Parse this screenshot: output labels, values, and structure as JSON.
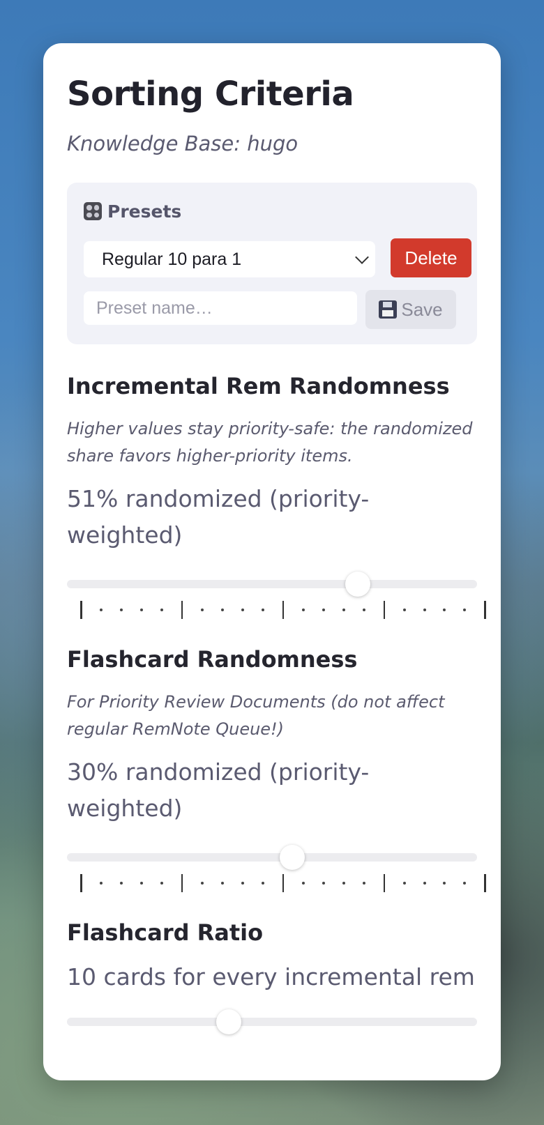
{
  "title": "Sorting Criteria",
  "subtitle": "Knowledge Base: hugo",
  "presets": {
    "heading": "Presets",
    "icon": "control-knobs-icon",
    "selected": "Regular 10 para 1",
    "delete_label": "Delete",
    "name_placeholder": "Preset name…",
    "save_label": "Save",
    "save_icon": "floppy-disk-icon"
  },
  "incremental": {
    "title": "Incremental Rem Randomness",
    "description": "Higher values stay priority-safe: the randomized share favors higher-priority items.",
    "value_text": "51% randomized (priority-weighted)",
    "slider_fraction": 0.71
  },
  "flashcard": {
    "title": "Flashcard Randomness",
    "description": "For Priority Review Documents (do not affect regular RemNote Queue!)",
    "value_text": "30% randomized (priority-weighted)",
    "slider_fraction": 0.55
  },
  "ratio": {
    "title": "Flashcard Ratio",
    "value_text": "10 cards for every incremental rem",
    "slider_fraction": 0.395
  },
  "colors": {
    "delete": "#d23a2c",
    "text_dark": "#22222c",
    "text_muted": "#5a5a70"
  }
}
